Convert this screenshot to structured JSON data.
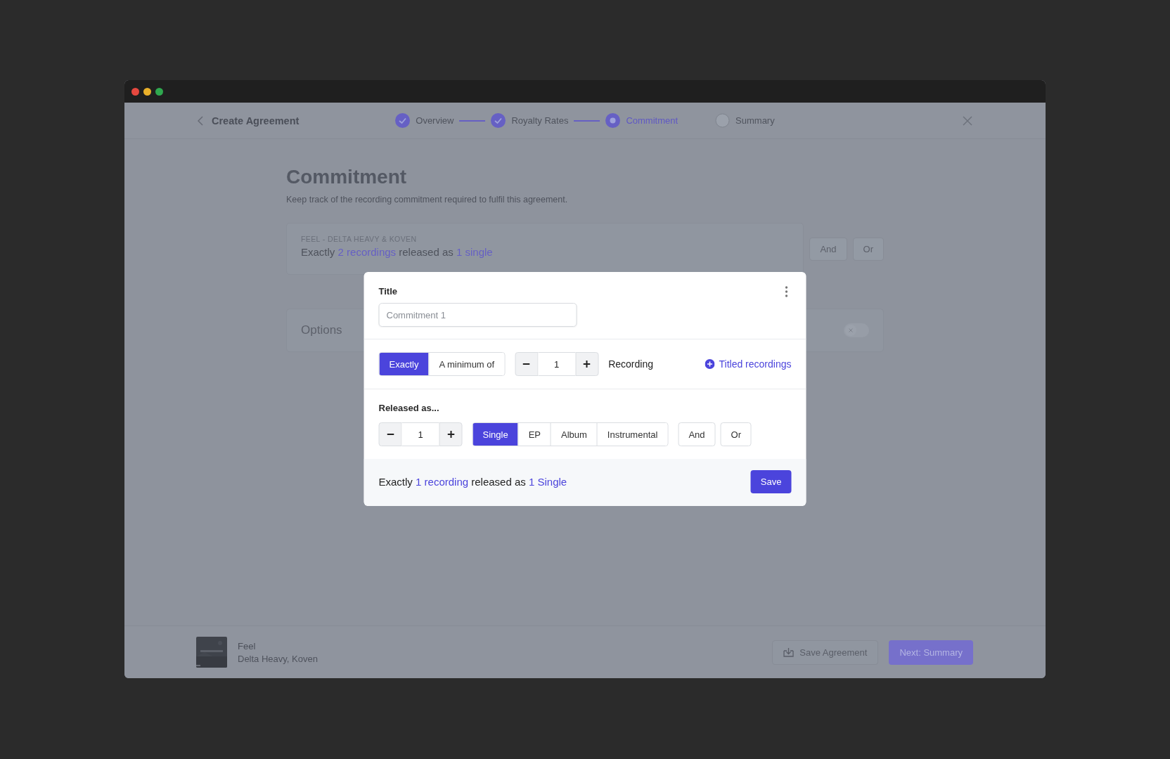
{
  "window": {
    "controls": [
      {
        "color": "#e5483f"
      },
      {
        "color": "#e9b02a"
      },
      {
        "color": "#2fa84f"
      }
    ]
  },
  "header": {
    "back_label": "Create Agreement",
    "steps": [
      {
        "label": "Overview",
        "completed": true,
        "selected": false
      },
      {
        "label": "Royalty Rates",
        "completed": true,
        "selected": false
      },
      {
        "label": "Commitment",
        "completed": false,
        "selected": true
      },
      {
        "label": "Summary",
        "completed": false,
        "selected": false
      }
    ]
  },
  "page": {
    "title": "Commitment",
    "subtitle": "Keep track of the recording commitment required to fulfil this agreement.",
    "commitment_card": {
      "label": "FEEL - DELTA HEAVY & KOVEN",
      "summary": [
        {
          "text": "Exactly",
          "kind": "plain"
        },
        {
          "text": "2 recordings",
          "kind": "accent"
        },
        {
          "text": "released as",
          "kind": "plain"
        },
        {
          "text": "1 single",
          "kind": "accent"
        }
      ]
    },
    "connectors": [
      {
        "label": "And"
      },
      {
        "label": "Or"
      }
    ],
    "options": {
      "label": "Options",
      "on": false
    }
  },
  "modal": {
    "title_label": "Title",
    "title_field": {
      "placeholder": "Commitment 1"
    },
    "quantifiers": [
      {
        "label": "Exactly",
        "selected": true
      },
      {
        "label": "A minimum of",
        "selected": false
      }
    ],
    "recording_count": {
      "value": "1"
    },
    "recording_unit": "Recording",
    "titled_recordings_link": "Titled recordings",
    "released_label": "Released as...",
    "release_count": {
      "value": "1"
    },
    "release_types": [
      {
        "label": "Single",
        "selected": true
      },
      {
        "label": "EP",
        "selected": false
      },
      {
        "label": "Album",
        "selected": false
      },
      {
        "label": "Instrumental",
        "selected": false
      }
    ],
    "connectors": [
      {
        "label": "And"
      },
      {
        "label": "Or"
      }
    ],
    "summary": [
      {
        "text": "Exactly",
        "kind": "plain"
      },
      {
        "text": "1 recording",
        "kind": "accent"
      },
      {
        "text": "released as",
        "kind": "plain"
      },
      {
        "text": "1 Single",
        "kind": "accent"
      }
    ],
    "save_button": "Save"
  },
  "footer": {
    "release": {
      "title": "Feel",
      "artists": "Delta Heavy, Koven"
    },
    "save_button": "Save Agreement",
    "next_button": "Next: Summary"
  }
}
